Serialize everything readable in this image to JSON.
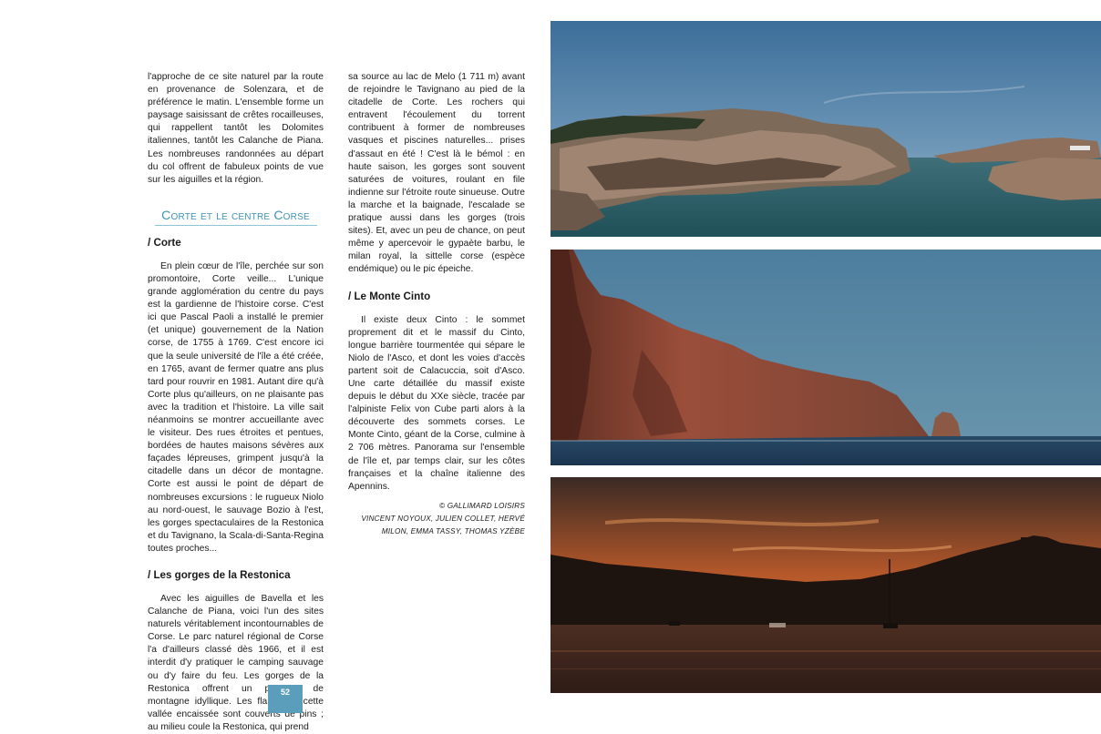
{
  "column_1": {
    "intro_paragraph": "l'approche de ce site naturel par la route en provenance de Solenzara, et de préférence le matin. L'ensemble forme un paysage saisissant de crêtes rocailleuses, qui rappellent tantôt les Dolomites italiennes, tantôt les Calanche de Piana. Les nombreuses randonnées au départ du col offrent de fabuleux points de vue sur les aiguilles et la région.",
    "section_title": "Corte et le centre Corse",
    "corte": {
      "heading": "/ Corte",
      "paragraph": "En plein cœur de l'île, perchée sur son promontoire, Corte veille... L'unique grande agglomération du centre du pays est la gardienne de l'histoire corse. C'est ici que Pascal Paoli a installé le premier (et unique) gouvernement de la Nation corse, de 1755 à 1769. C'est encore ici que la seule université de l'île a été créée, en 1765, avant de fermer quatre ans plus tard pour rouvrir en 1981. Autant dire qu'à Corte plus qu'ailleurs, on ne plaisante pas avec la tradition et l'histoire. La ville sait néanmoins se montrer accueillante avec le visiteur. Des rues étroites et pentues, bordées de hautes maisons sévères aux façades lépreuses, grimpent jusqu'à la citadelle dans un décor de montagne. Corte est aussi le point de départ de nombreuses excursions : le rugueux Niolo au nord-ouest, le sauvage Bozio à l'est, les gorges spectaculaires de la Restonica et du Tavignano, la Scala-di-Santa-Regina toutes proches..."
    },
    "restonica": {
      "heading": "/ Les gorges de la Restonica",
      "paragraph": "Avec les aiguilles de Bavella et les Calanche de Piana, voici l'un des sites naturels véritablement incontournables de Corse. Le parc naturel régional de Corse l'a d'ailleurs classé dès 1966, et il est interdit d'y pratiquer le camping sauvage ou d'y faire du feu. Les gorges de la Restonica offrent un paysage de montagne idyllique. Les flancs de cette vallée encaissée sont couverts de pins ; au milieu coule la Restonica, qui prend"
    }
  },
  "column_2": {
    "continuation_paragraph": "sa source au lac de Melo (1 711 m) avant de rejoindre le Tavignano au pied de la citadelle de Corte. Les rochers qui entravent l'écoulement du torrent contribuent à former de nombreuses vasques et piscines naturelles... prises d'assaut en été ! C'est là le bémol : en haute saison, les gorges sont souvent saturées de voitures, roulant en file indienne sur l'étroite route sinueuse. Outre la marche et la baignade, l'escalade se pratique aussi dans les gorges (trois sites). Et, avec un peu de chance, on peut même y apercevoir le gypaète barbu, le milan royal, la sittelle corse (espèce endémique) ou le pic épeiche.",
    "monte_cinto": {
      "heading": "/ Le Monte Cinto",
      "paragraph": "Il existe deux Cinto : le sommet proprement dit et le massif du Cinto, longue barrière tourmentée qui sépare le Niolo de l'Asco, et dont les voies d'accès partent soit de Calacuccia, soit d'Asco. Une carte détaillée du massif existe depuis le début du XXe siècle, tracée par l'alpiniste Felix von Cube parti alors à la découverte des sommets corses. Le Monte Cinto, géant de la Corse, culmine à 2 706 mètres. Panorama sur l'ensemble de l'île et, par temps clair, sur les côtes françaises et la chaîne italienne des Apennins."
    },
    "credit": {
      "line_1": "© GALLIMARD LOISIRS",
      "line_2": "VINCENT NOYOUX, JULIEN COLLET, HERVÉ",
      "line_3": "MILON, EMMA TASSY, THOMAS YZÈBE"
    }
  },
  "page_number": "52",
  "colors": {
    "accent": "#3f93b5",
    "page_number_bg": "#5b9ebb",
    "body_text": "#1a1a1a"
  }
}
